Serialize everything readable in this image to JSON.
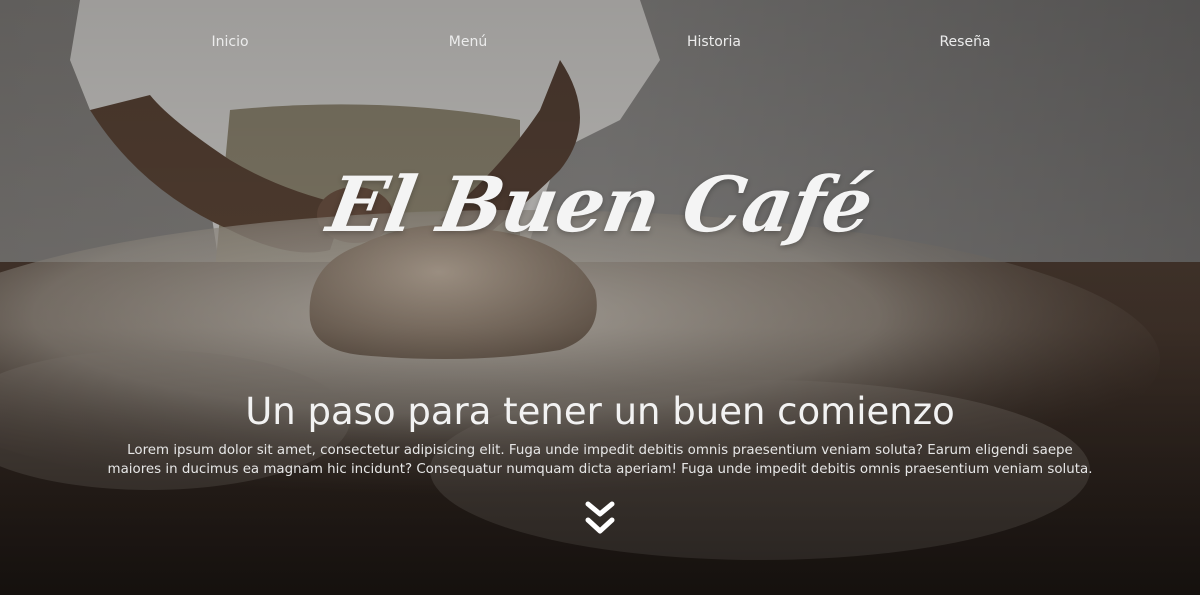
{
  "nav": {
    "items": [
      {
        "label": "Inicio"
      },
      {
        "label": "Menú"
      },
      {
        "label": "Historia"
      },
      {
        "label": "Reseña"
      }
    ]
  },
  "hero": {
    "brand": "El Buen Café",
    "headline": "Un paso para tener un buen comienzo",
    "intro": "Lorem ipsum dolor sit amet, consectetur adipisicing elit. Fuga unde impedit debitis omnis praesentium veniam soluta? Earum eligendi saepe maiores in ducimus ea magnam hic incidunt? Consequatur numquam dicta aperiam! Fuga unde impedit debitis omnis praesentium veniam soluta.",
    "scroll_icon": "double-chevron-down-icon"
  },
  "colors": {
    "text": "#ffffff",
    "overlay": "#1c1a18"
  }
}
